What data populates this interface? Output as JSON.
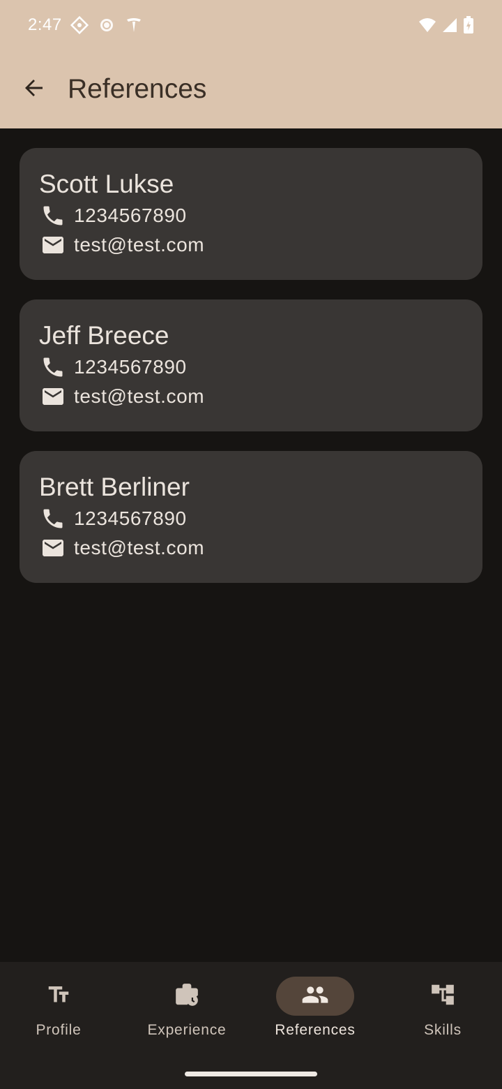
{
  "status_bar": {
    "time": "2:47",
    "icons_left": [
      "compass-diamond-icon",
      "coin-icon",
      "tesla-logo-icon"
    ],
    "icons_right": [
      "wifi-icon",
      "cell-signal-icon",
      "battery-charging-icon"
    ]
  },
  "app_bar": {
    "title": "References",
    "back_icon": "arrow-back-icon"
  },
  "references": [
    {
      "name": "Scott Lukse",
      "phone": "1234567890",
      "email": "test@test.com"
    },
    {
      "name": "Jeff Breece",
      "phone": "1234567890",
      "email": "test@test.com"
    },
    {
      "name": "Brett Berliner",
      "phone": "1234567890",
      "email": "test@test.com"
    }
  ],
  "bottom_nav": {
    "items": [
      {
        "label": "Profile",
        "icon": "text-fields-icon",
        "active": false
      },
      {
        "label": "Experience",
        "icon": "work-history-icon",
        "active": false
      },
      {
        "label": "References",
        "icon": "people-icon",
        "active": true
      },
      {
        "label": "Skills",
        "icon": "account-tree-icon",
        "active": false
      }
    ]
  },
  "colors": {
    "header_bg": "#dbc4ae",
    "background": "#161412",
    "card_bg": "#393634",
    "nav_bg": "#221f1d",
    "active_pill": "#54453a"
  }
}
